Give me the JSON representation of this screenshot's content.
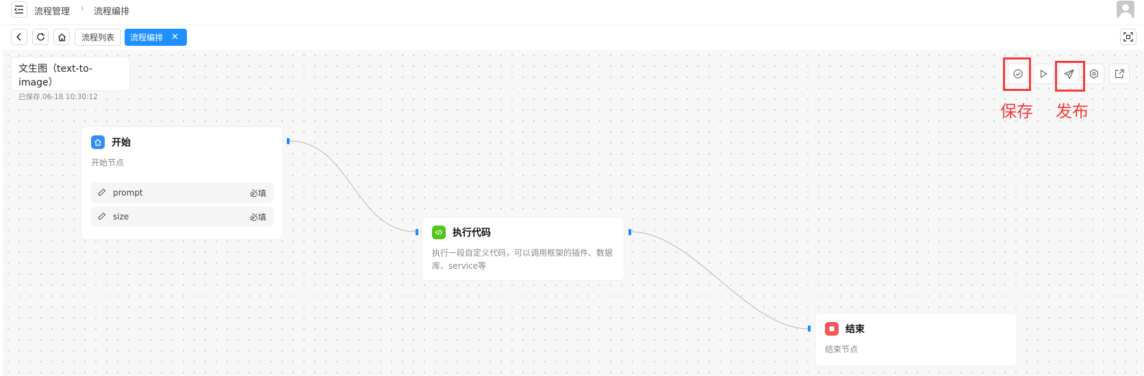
{
  "header": {
    "breadcrumb": [
      "流程管理",
      "流程编排"
    ],
    "menu_icon": "menu-fold-icon",
    "avatar_icon": "user-avatar-icon"
  },
  "tabs": {
    "nav_icons": [
      "back-icon",
      "refresh-icon",
      "home-icon"
    ],
    "items": [
      {
        "label": "流程列表",
        "active": false
      },
      {
        "label": "流程编排",
        "active": true
      }
    ],
    "close_glyph": "✕",
    "fullscreen_icon": "fullscreen-icon"
  },
  "workflow": {
    "name": "文生图（text-to-image）",
    "saved_status": "已保存 06-18 10:30:12"
  },
  "toolbar": {
    "buttons": [
      "save-check-icon",
      "run-play-icon",
      "publish-send-icon",
      "settings-icon",
      "export-icon"
    ],
    "annotations": {
      "save": "保存",
      "publish": "发布"
    }
  },
  "nodes": {
    "start": {
      "title": "开始",
      "desc": "开始节点",
      "params": [
        {
          "name": "prompt",
          "required": "必填"
        },
        {
          "name": "size",
          "required": "必填"
        }
      ]
    },
    "code": {
      "title": "执行代码",
      "desc_line1": "执行一段自定义代码，可以调用框架的插件、数据",
      "desc_line2": "库、service等"
    },
    "end": {
      "title": "结束",
      "desc": "结束节点"
    }
  },
  "colors": {
    "accent": "#1e90ff",
    "annotation": "#f03c3c",
    "start_icon": "#2f8df5",
    "code_icon": "#52c41a",
    "end_icon": "#f05a5a"
  }
}
